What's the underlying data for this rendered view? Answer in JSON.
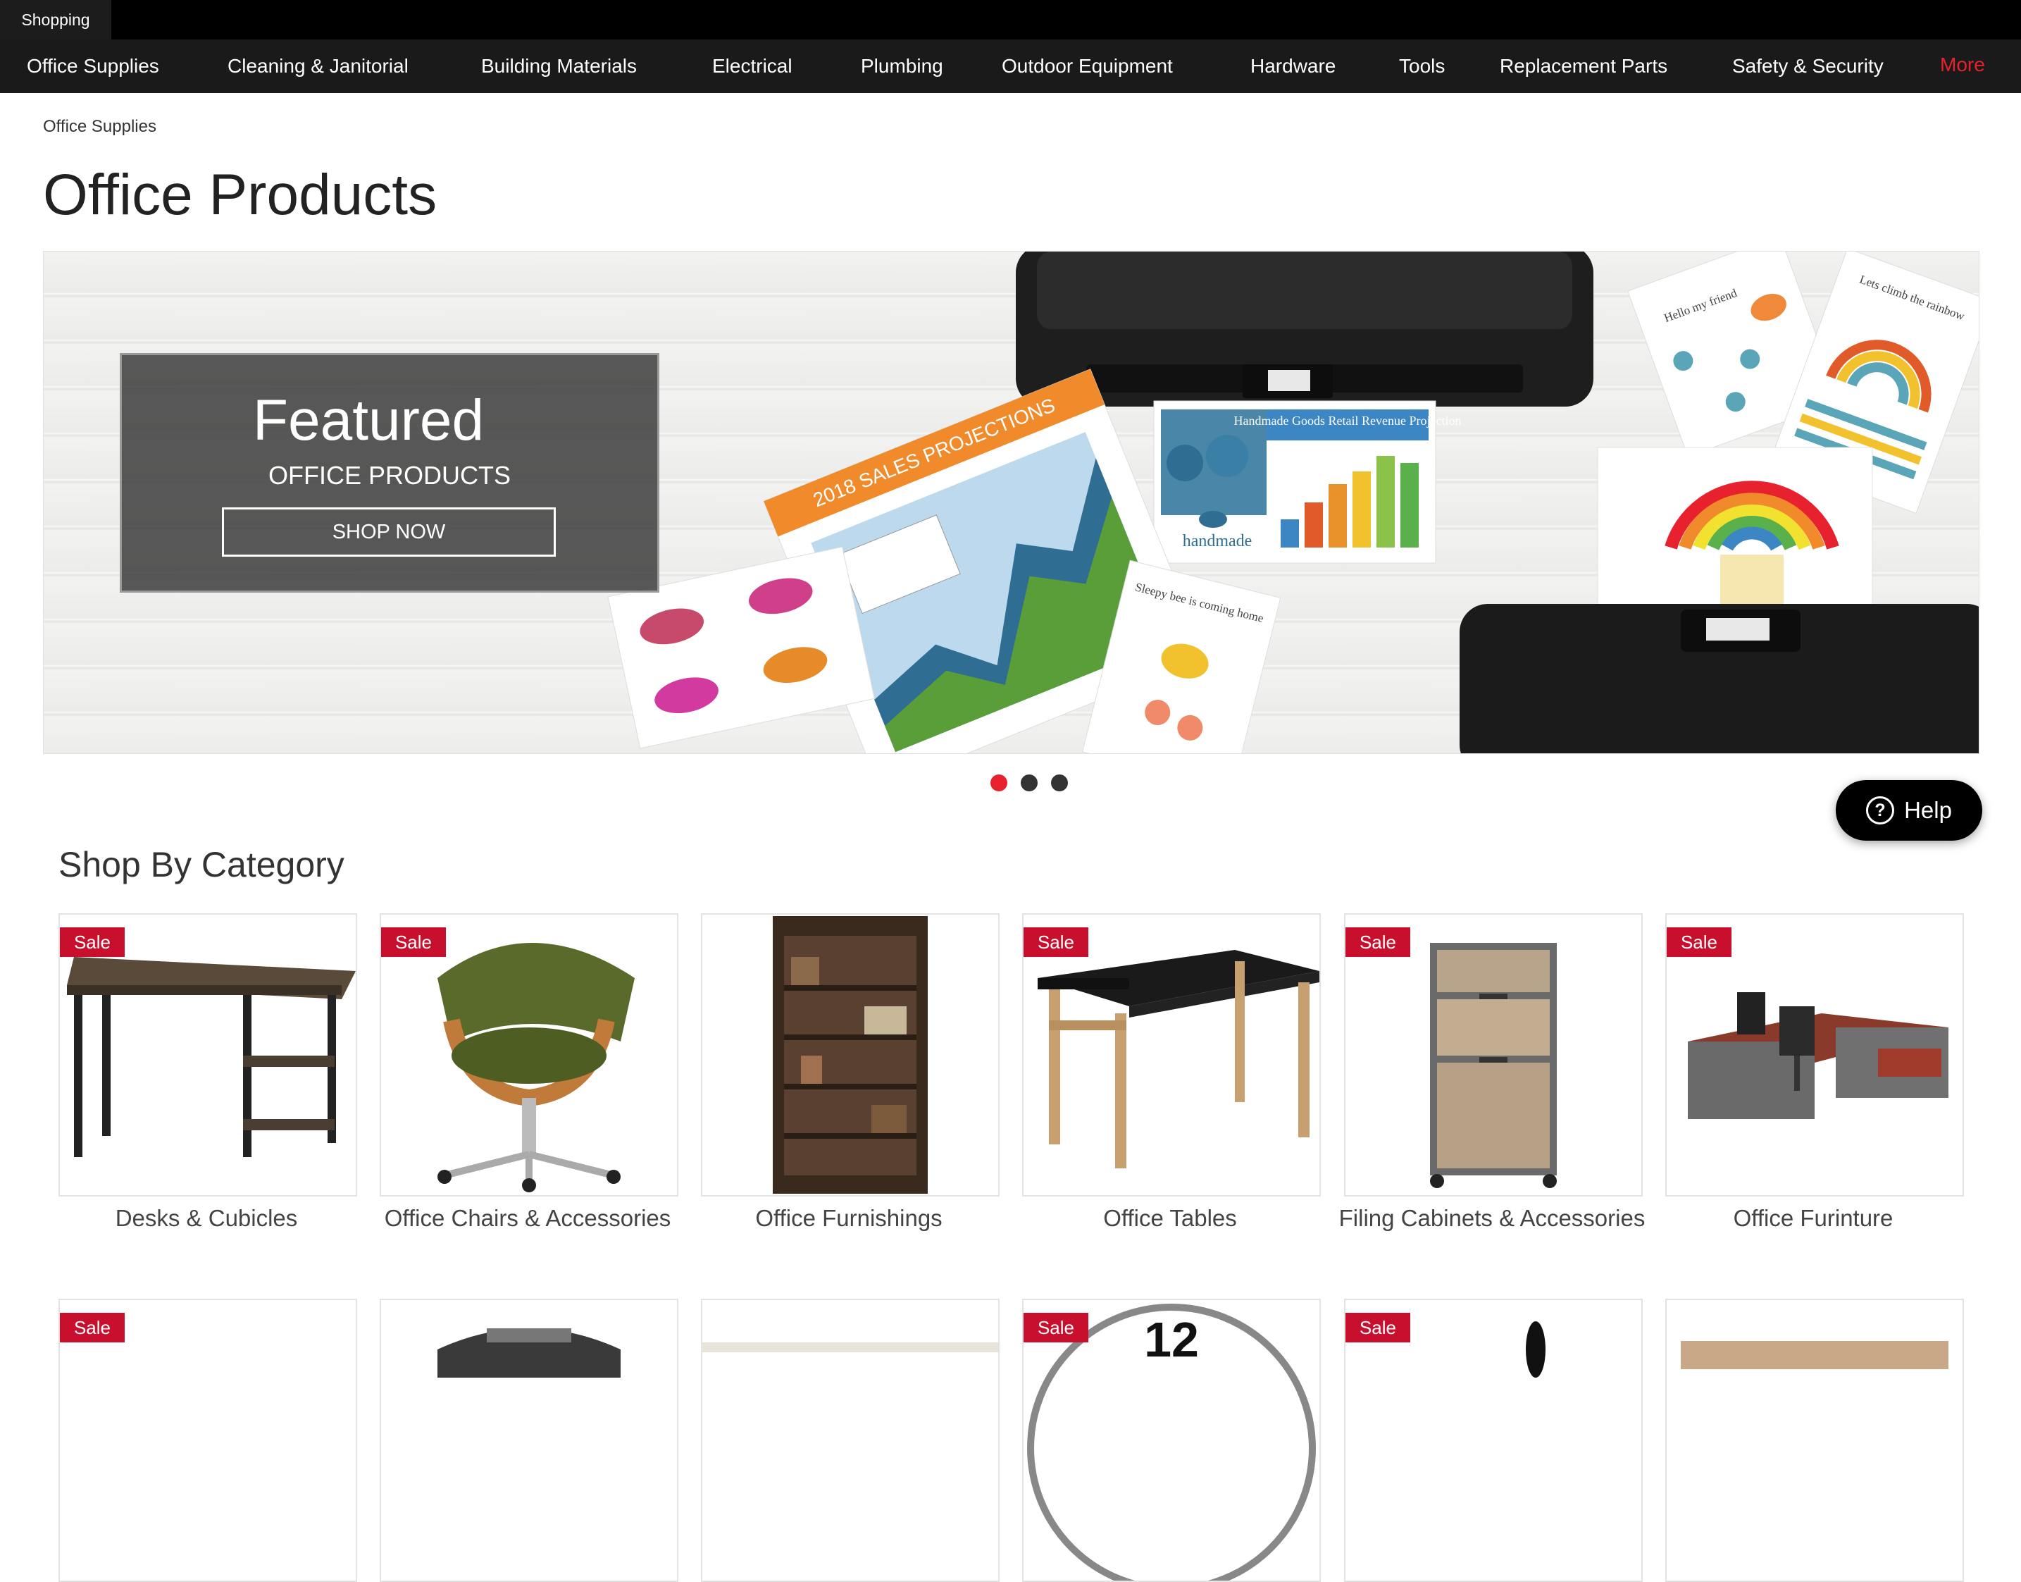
{
  "topbar": {
    "tab_label": "Shopping"
  },
  "nav": {
    "items": [
      "Office Supplies",
      "Cleaning & Janitorial",
      "Building Materials",
      "Electrical",
      "Plumbing",
      "Outdoor Equipment",
      "Hardware",
      "Tools",
      "Replacement Parts",
      "Safety & Security"
    ],
    "more_label": "More"
  },
  "breadcrumb": "Office Supplies",
  "page_title": "Office Products",
  "hero": {
    "title": "Featured",
    "subtitle": "OFFICE PRODUCTS",
    "button_label": "SHOP NOW",
    "chart_sheet_title": "2018 SALES PROJECTIONS",
    "revenue_sheet_title": "Handmade Goods Retail Revenue Projection",
    "revenue_sheet_logo": "handmade",
    "card_hello": "Hello my friend",
    "card_rainbow": "Lets climb the rainbow",
    "card_bee": "Sleepy bee is coming home",
    "carousel_active_index": 0,
    "carousel_count": 3
  },
  "help": {
    "label": "Help",
    "icon": "question-circle-icon"
  },
  "section_title": "Shop By Category",
  "sale_label": "Sale",
  "colors": {
    "accent": "#e8212e",
    "sale": "#c8102e",
    "nav_bg": "#1a1a1a"
  },
  "categories": [
    {
      "label": "Desks & Cubicles",
      "sale": true,
      "icon": "desk-image"
    },
    {
      "label": "Office Chairs & Accessories",
      "sale": true,
      "icon": "chair-image"
    },
    {
      "label": "Office Furnishings",
      "sale": false,
      "icon": "bookcase-image"
    },
    {
      "label": "Office Tables",
      "sale": true,
      "icon": "table-image"
    },
    {
      "label": "Filing Cabinets & Accessories",
      "sale": true,
      "icon": "filing-cabinet-image"
    },
    {
      "label": "Office Furinture",
      "sale": true,
      "icon": "office-desk-image"
    },
    {
      "label": "",
      "sale": true,
      "icon": "product-image"
    },
    {
      "label": "",
      "sale": false,
      "icon": "shredder-image"
    },
    {
      "label": "",
      "sale": false,
      "icon": "product-image"
    },
    {
      "label": "",
      "sale": true,
      "icon": "wall-clock-image"
    },
    {
      "label": "",
      "sale": true,
      "icon": "product-image"
    },
    {
      "label": "",
      "sale": false,
      "icon": "product-image"
    }
  ]
}
